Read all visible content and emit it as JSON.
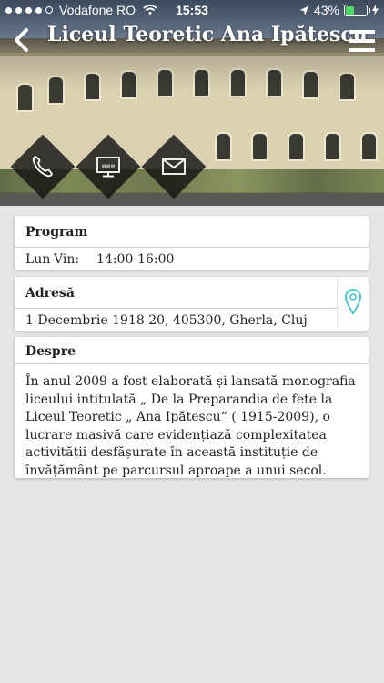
{
  "status_bar": {
    "carrier": "Vodafone RO",
    "time": "15:53",
    "battery_percent": "43%",
    "battery_level": 0.43,
    "signal_bars": 4,
    "battery_color": "#4cd964"
  },
  "header": {
    "title": "Liceul Teoretic Ana Ipătescu",
    "back_icon": "chevron-left-icon",
    "menu_icon": "hamburger-menu-icon"
  },
  "quick_actions": [
    {
      "name": "phone",
      "icon": "phone-icon"
    },
    {
      "name": "website",
      "icon": "www-monitor-icon"
    },
    {
      "name": "email",
      "icon": "envelope-icon"
    }
  ],
  "program": {
    "title": "Program",
    "day_label": "Lun-Vin:",
    "hours": "14:00-16:00"
  },
  "address": {
    "title": "Adresă",
    "value": "1 Decembrie 1918 20, 405300, Gherla, Cluj",
    "map_icon": "map-pin-icon",
    "accent": "#3ec3c9"
  },
  "about": {
    "title": "Despre",
    "text": "În anul 2009 a fost elaborată și lansată monografia liceului intitulată „ De la Preparandia de fete la Liceul Teoretic „ Ana Ipătescu“ ( 1915-2009), o lucrare masivă care evidențiază complexitatea activității desfășurate în această instituție de învățământ pe parcursul aproape a unui secol."
  }
}
